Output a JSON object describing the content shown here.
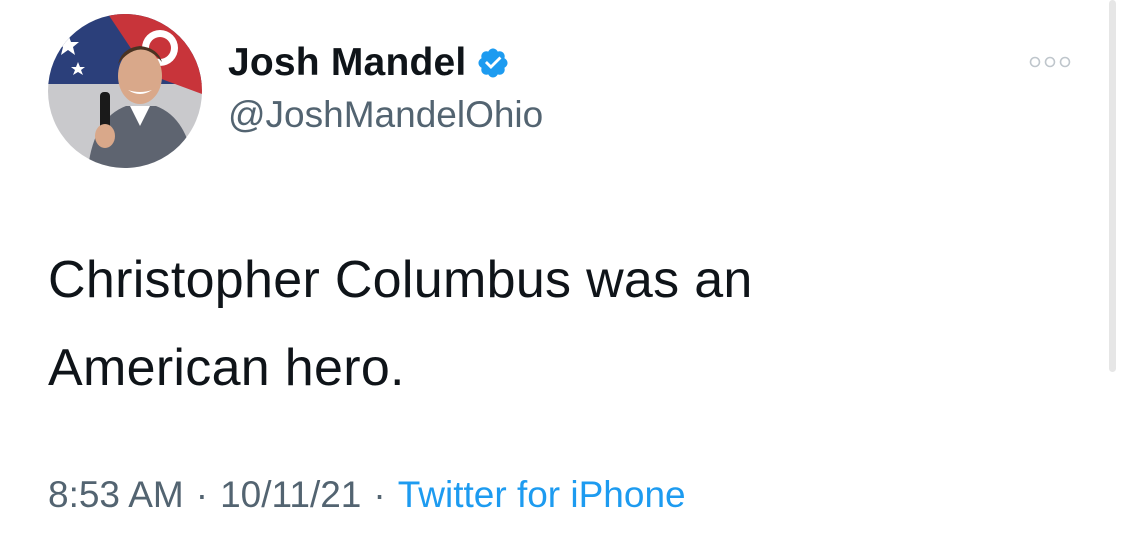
{
  "author": {
    "display_name": "Josh Mandel",
    "handle": "@JoshMandelOhio",
    "verified": true,
    "avatar_icon": "profile-photo"
  },
  "tweet": {
    "text_line1": "Christopher Columbus was an",
    "text_line2": "American hero."
  },
  "meta": {
    "time": "8:53 AM",
    "separator": "·",
    "date": "10/11/21",
    "source": "Twitter for iPhone"
  },
  "icons": {
    "verified": "verified-badge-icon",
    "more": "more-options-icon"
  },
  "colors": {
    "verified_badge": "#1d9bf0",
    "link": "#1d9bf0",
    "secondary_text": "#536471",
    "primary_text": "#0f1419"
  }
}
